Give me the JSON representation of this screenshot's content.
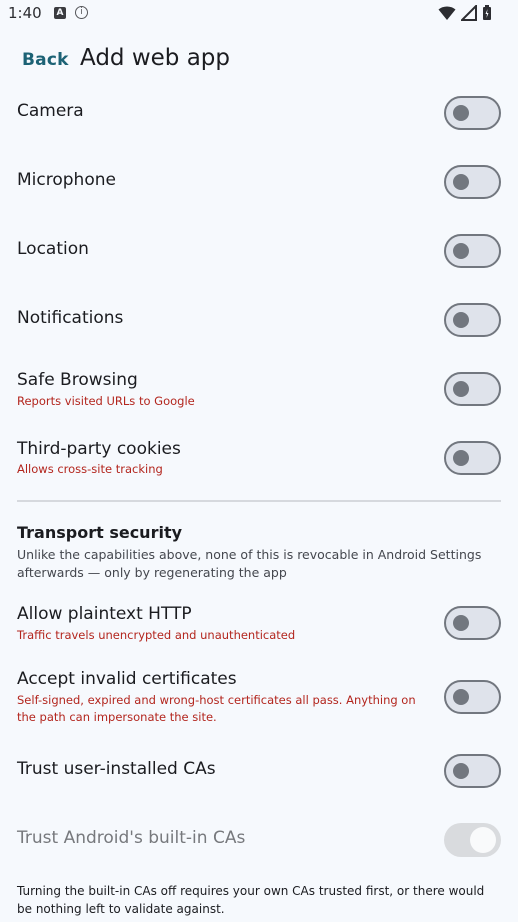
{
  "status_bar": {
    "time": "1:40",
    "notif_a": "A",
    "notif_info": "i",
    "icons": [
      "wifi-icon",
      "signal-icon",
      "battery-icon"
    ]
  },
  "header": {
    "back_label": "Back",
    "title": "Add web app"
  },
  "permissions": [
    {
      "label": "Camera",
      "sub": "",
      "state": "off"
    },
    {
      "label": "Microphone",
      "sub": "",
      "state": "off"
    },
    {
      "label": "Location",
      "sub": "",
      "state": "off"
    },
    {
      "label": "Notifications",
      "sub": "",
      "state": "off"
    },
    {
      "label": "Safe Browsing",
      "sub": "Reports visited URLs to Google",
      "state": "off"
    },
    {
      "label": "Third-party cookies",
      "sub": "Allows cross-site tracking",
      "state": "off"
    }
  ],
  "transport": {
    "title": "Transport security",
    "description": "Unlike the capabilities above, none of this is revocable in Android Settings afterwards — only by regenerating the app",
    "items": [
      {
        "label": "Allow plaintext HTTP",
        "sub": "Traffic travels unencrypted and unauthenticated",
        "state": "off"
      },
      {
        "label": "Accept invalid certificates",
        "sub": "Self-signed, expired and wrong-host certificates all pass. Anything on the path can impersonate the site.",
        "state": "off"
      },
      {
        "label": "Trust user-installed CAs",
        "sub": "",
        "state": "off"
      },
      {
        "label": "Trust Android's built-in CAs",
        "sub": "",
        "state": "on, disabled"
      }
    ],
    "footer": "Turning the built-in CAs off requires your own CAs trusted first, or there would be nothing left to validate against."
  },
  "colors": {
    "background": "#f6f9fd",
    "accent": "#1c6275",
    "warning_text": "#b3261e",
    "toggle_outline": "#72777f"
  }
}
